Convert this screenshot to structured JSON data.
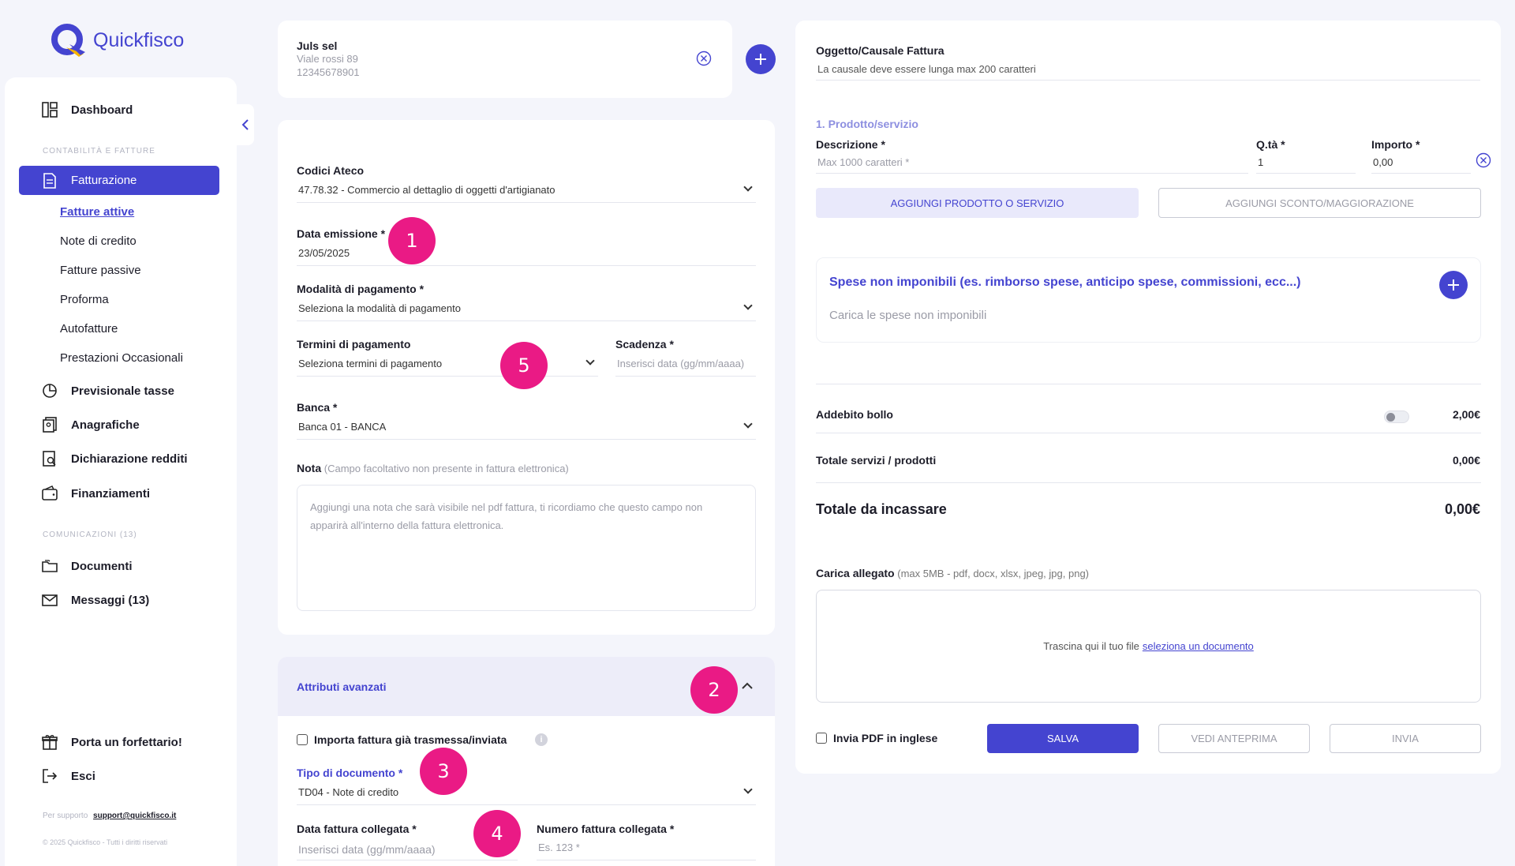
{
  "app": {
    "brand": "Quickfisco"
  },
  "sidebar": {
    "dashboard": "Dashboard",
    "section_accounting": "CONTABILITÀ E FATTURE",
    "fatturazione": "Fatturazione",
    "sub_items": [
      "Fatture attive",
      "Note di credito",
      "Fatture passive",
      "Proforma",
      "Autofatture",
      "Prestazioni Occasionali"
    ],
    "previsionale": "Previsionale tasse",
    "anagrafiche": "Anagrafiche",
    "dichiarazione": "Dichiarazione redditi",
    "finanziamenti": "Finanziamenti",
    "section_comms": "COMUNICAZIONI (13)",
    "documenti": "Documenti",
    "messaggi": "Messaggi (13)",
    "porta": "Porta un forfettario!",
    "esci": "Esci",
    "support_prefix": "Per supporto",
    "support_email": "support@quickfisco.it",
    "copyright": "© 2025 Quickfisco - Tutti i diritti riservati"
  },
  "customer": {
    "name": "Juls sel",
    "address": "Viale rossi 89",
    "vat": "12345678901"
  },
  "form": {
    "ateco_label": "Codici Ateco",
    "ateco_value": "47.78.32 - Commercio al dettaglio di oggetti d'artigianato",
    "date_label": "Data emissione *",
    "date_value": "23/05/2025",
    "payment_mode_label": "Modalità di pagamento *",
    "payment_mode_value": "Seleziona la modalità di pagamento",
    "payment_terms_label": "Termini di pagamento",
    "payment_terms_value": "Seleziona termini di pagamento",
    "due_label": "Scadenza *",
    "due_placeholder": "Inserisci data (gg/mm/aaaa)",
    "bank_label": "Banca *",
    "bank_value": "Banca 01 - BANCA",
    "note_label": "Nota",
    "note_hint": "(Campo facoltativo non presente in fattura elettronica)",
    "note_placeholder": "Aggiungi una nota che sarà visibile nel pdf fattura, ti ricordiamo che questo campo non apparirà all'interno della fattura elettronica."
  },
  "advanced": {
    "title": "Attributi avanzati",
    "import_label": "Importa fattura già trasmessa/inviata",
    "doc_type_label": "Tipo di documento *",
    "doc_type_value": "TD04 - Note di credito",
    "linked_date_label": "Data fattura collegata *",
    "linked_date_placeholder": "Inserisci data (gg/mm/aaaa)",
    "linked_number_label": "Numero fattura collegata *",
    "linked_number_placeholder": "Es. 123 *"
  },
  "markers": [
    "1",
    "5",
    "2",
    "3",
    "4"
  ],
  "right": {
    "object_label": "Oggetto/Causale Fattura",
    "object_placeholder": "La causale deve essere lunga max 200 caratteri",
    "product_section": "1. Prodotto/servizio",
    "desc_label": "Descrizione *",
    "desc_placeholder": "Max 1000 caratteri *",
    "qty_label": "Q.tà *",
    "qty_value": "1",
    "amount_label": "Importo *",
    "amount_value": "0,00",
    "add_product": "AGGIUNGI PRODOTTO O SERVIZIO",
    "add_discount": "AGGIUNGI SCONTO/MAGGIORAZIONE",
    "expenses_title": "Spese non imponibili (es. rimborso spese, anticipo spese, commissioni, ecc...)",
    "expenses_placeholder": "Carica le spese non imponibili",
    "stamp_label": "Addebito bollo",
    "stamp_value": "2,00€",
    "total_services_label": "Totale servizi / prodotti",
    "total_services_value": "0,00€",
    "total_label": "Totale da incassare",
    "total_value": "0,00€",
    "attach_label": "Carica allegato",
    "attach_hint": "(max 5MB - pdf, docx, xlsx, jpeg, jpg, png)",
    "drop_text": "Trascina qui il tuo file",
    "drop_link": "seleziona un documento",
    "english_pdf": "Invia PDF in inglese",
    "save": "SALVA",
    "preview": "VEDI ANTEPRIMA",
    "send": "INVIA"
  },
  "colors": {
    "accent": "#4444d0",
    "marker": "#ea1a85",
    "light_accent": "#e9e9fb"
  }
}
